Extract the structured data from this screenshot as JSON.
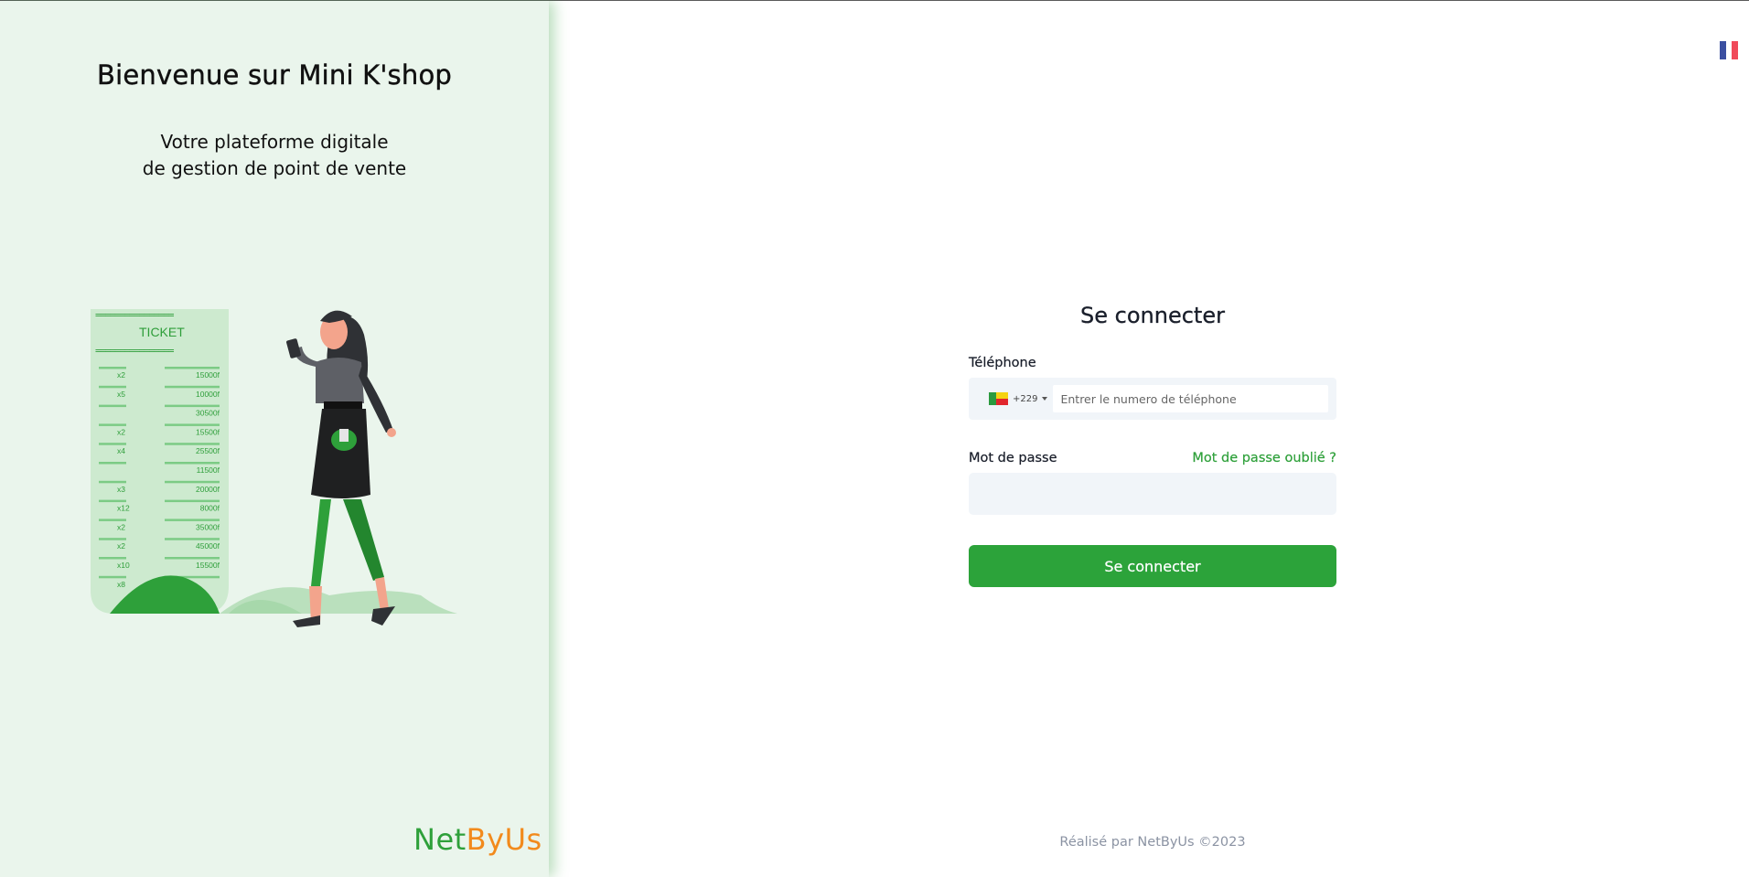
{
  "welcome": {
    "title": "Bienvenue sur Mini K'shop",
    "subtitle_line1": "Votre plateforme digitale",
    "subtitle_line2": "de gestion de point de vente"
  },
  "illustration": {
    "ticket_title": "TICKET",
    "ticket_separator": "================",
    "quantities": [
      "x2",
      "x5",
      "",
      "x2",
      "x4",
      "",
      "x3",
      "x12",
      "x2",
      "x2",
      "x10",
      "x8"
    ],
    "amounts": [
      "15000f",
      "10000f",
      "30500f",
      "15500f",
      "25500f",
      "11500f",
      "20000f",
      "8000f",
      "35000f",
      "45000f",
      "15500f",
      ""
    ]
  },
  "brand": {
    "logo_part1": "Net",
    "logo_part2": "ByUs"
  },
  "language": {
    "flag": "fr-flag-icon",
    "colors": [
      "#3b4fa0",
      "#ffffff",
      "#f04a5a"
    ]
  },
  "login": {
    "title": "Se connecter",
    "phone_label": "Téléphone",
    "country_dial_code": "+229",
    "phone_placeholder": "Entrer le numero de téléphone",
    "phone_value": "",
    "password_label": "Mot de passe",
    "forgot_password": "Mot de passe oublié ?",
    "password_value": "",
    "submit_label": "Se connecter"
  },
  "footer": {
    "text": "Réalisé par NetByUs  ©2023"
  },
  "colors": {
    "accent": "#2ca33a",
    "panel_bg": "#eaf5ec",
    "logo_orange": "#f28a1c"
  }
}
